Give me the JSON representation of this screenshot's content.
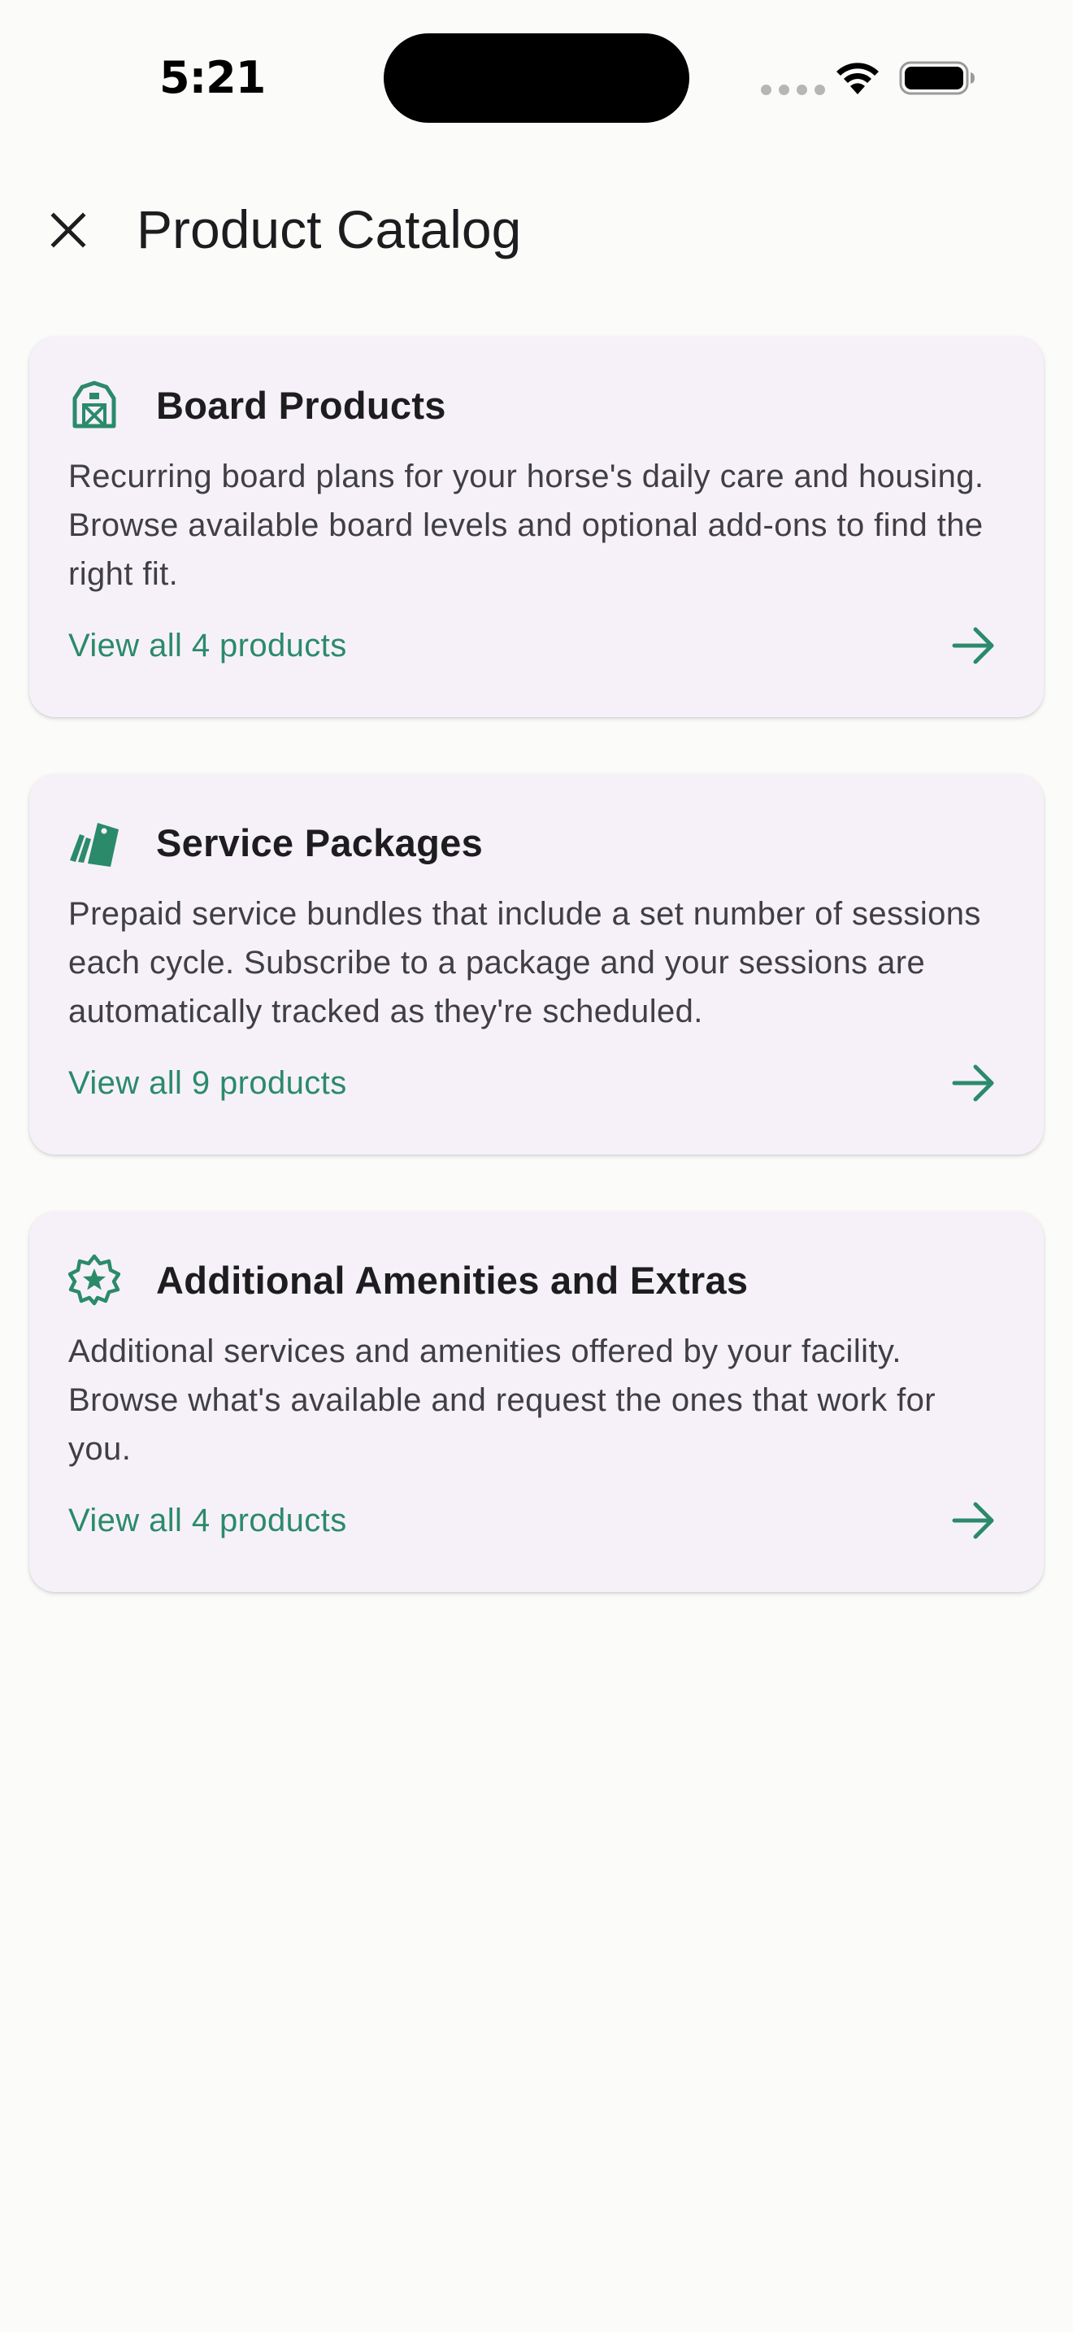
{
  "status_bar": {
    "time": "5:21"
  },
  "app_bar": {
    "title": "Product Catalog",
    "close_icon": "close-icon"
  },
  "colors": {
    "accent": "#2b8a6a",
    "card_background": "#f6f1f8",
    "page_background": "#fbfcfa"
  },
  "cards": [
    {
      "icon": "barn-icon",
      "title": "Board Products",
      "description": "Recurring board plans for your horse's daily care and housing. Browse available board levels and optional add-ons to find the right fit.",
      "link": "View all 4 products"
    },
    {
      "icon": "price-tags-icon",
      "title": "Service Packages",
      "description": "Prepaid service bundles that include a set number of sessions each cycle. Subscribe to a package and your sessions are automatically tracked as they're scheduled.",
      "link": "View all 9 products"
    },
    {
      "icon": "star-badge-icon",
      "title": "Additional Amenities and Extras",
      "description": "Additional services and amenities offered by your facility. Browse what's available and request the ones that work for you.",
      "link": "View all 4 products"
    }
  ]
}
